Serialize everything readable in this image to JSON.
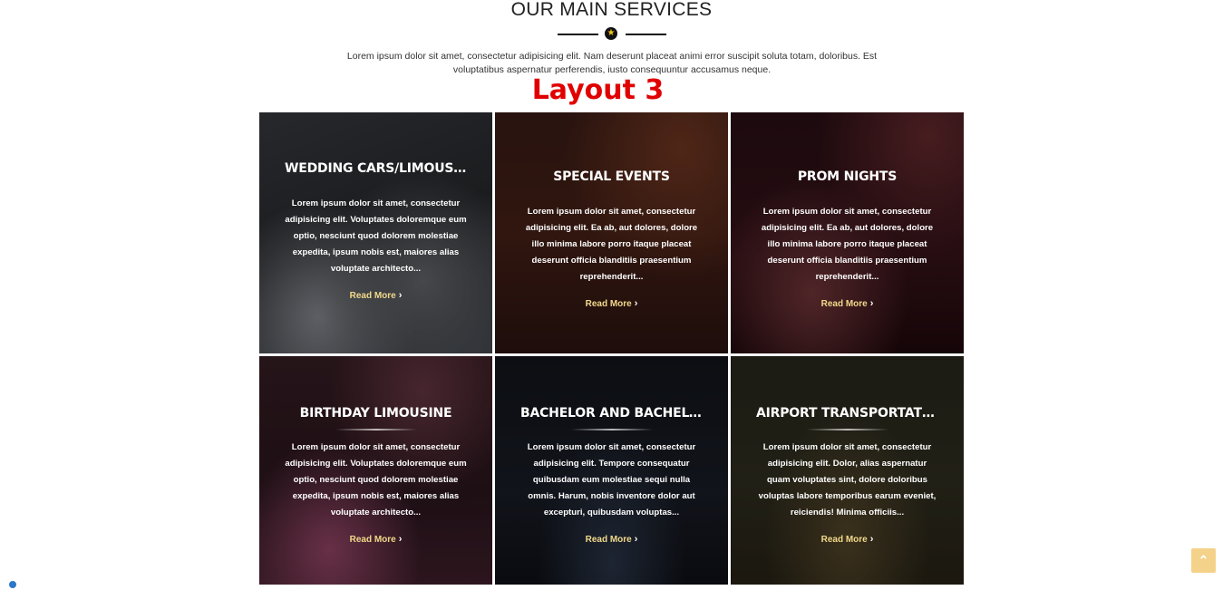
{
  "section": {
    "title": "OUR MAIN SERVICES",
    "intro": "Lorem ipsum dolor sit amet, consectetur adipisicing elit. Nam deserunt placeat animi error suscipit soluta totam, doloribus. Est voluptatibus aspernatur perferendis, iusto consequuntur accusamus neque.",
    "layout_label": "Layout 3",
    "divider_icon": "star-icon"
  },
  "cards": [
    {
      "title": "WEDDING CARS/LIMOUSINE",
      "text": "Lorem ipsum dolor sit amet, consectetur adipisicing elit. Voluptates doloremque eum optio, nesciunt quod dolorem molestiae expedita, ipsum nobis est, maiores alias voluptate architecto...",
      "link": "Read More"
    },
    {
      "title": "SPECIAL EVENTS",
      "text": "Lorem ipsum dolor sit amet, consectetur adipisicing elit. Ea ab, aut dolores, dolore illo minima labore porro itaque placeat deserunt officia blanditiis praesentium reprehenderit...",
      "link": "Read More"
    },
    {
      "title": "PROM NIGHTS",
      "text": "Lorem ipsum dolor sit amet, consectetur adipisicing elit. Ea ab, aut dolores, dolore illo minima labore porro itaque placeat deserunt officia blanditiis praesentium reprehenderit...",
      "link": "Read More"
    },
    {
      "title": "BIRTHDAY LIMOUSINE",
      "text": "Lorem ipsum dolor sit amet, consectetur adipisicing elit. Voluptates doloremque eum optio, nesciunt quod dolorem molestiae expedita, ipsum nobis est, maiores alias voluptate architecto...",
      "link": "Read More"
    },
    {
      "title": "BACHELOR AND BACHELORET...",
      "text": "Lorem ipsum dolor sit amet, consectetur adipisicing elit. Tempore consequatur quibusdam eum molestiae sequi nulla omnis. Harum, nobis inventore dolor aut excepturi, quibusdam voluptas...",
      "link": "Read More"
    },
    {
      "title": "AIRPORT TRANSPORTATION",
      "text": "Lorem ipsum dolor sit amet, consectetur adipisicing elit. Dolor, alias aspernatur quam voluptates sint, dolore doloribus voluptas labore temporibus earum eveniet, reiciendis! Minima officiis...",
      "link": "Read More"
    }
  ],
  "colors": {
    "accent": "#f1d98a",
    "layout_label": "#e00000",
    "scroll_top": "#f4d28a"
  },
  "scroll_top_icon": "chevron-up-icon"
}
